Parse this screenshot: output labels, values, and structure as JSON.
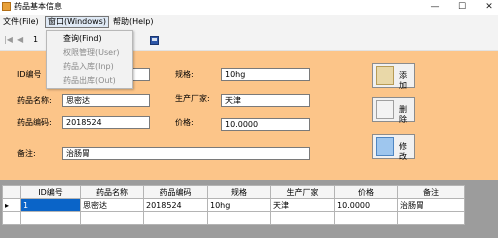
{
  "window": {
    "title": "药品基本信息",
    "min": "—",
    "max": "☐",
    "close": "✕"
  },
  "menu": {
    "file": "文件(File)",
    "window": "窗口(Windows)",
    "help": "帮助(Help)"
  },
  "dropdown": {
    "items": [
      {
        "label": "查询(Find)"
      },
      {
        "label": "权限管理(User)"
      },
      {
        "label": "药品入库(Inp)"
      },
      {
        "label": "药品出库(Out)"
      }
    ]
  },
  "toolbar": {
    "first": "|◀",
    "prev": "◀",
    "position": "1"
  },
  "form": {
    "id_label": "ID编号",
    "id_value": "",
    "name_label": "药品名称:",
    "name_value": "思密达",
    "code_label": "药品编码:",
    "code_value": "2018524",
    "spec_label": "规格:",
    "spec_value": "10hg",
    "maker_label": "生产厂家:",
    "maker_value": "天津",
    "price_label": "价格:",
    "price_value": "10.0000",
    "note_label": "备注:",
    "note_value": "治肠胃"
  },
  "buttons": {
    "add": "添加",
    "delete": "删除",
    "modify": "修改"
  },
  "table": {
    "columns": [
      "ID编号",
      "药品名称",
      "药品编码",
      "规格",
      "生产厂家",
      "价格",
      "备注"
    ],
    "rows": [
      [
        "1",
        "思密达",
        "2018524",
        "10hg",
        "天津",
        "10.0000",
        "治肠胃"
      ]
    ]
  }
}
